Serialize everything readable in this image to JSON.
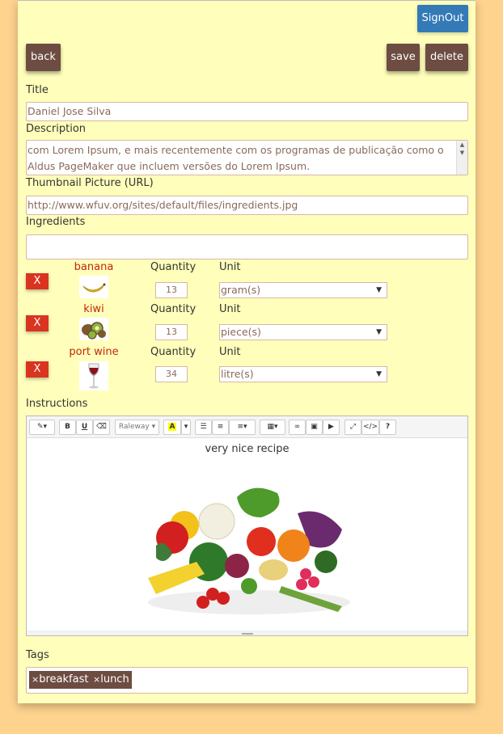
{
  "header": {
    "signout_label": "SignOut"
  },
  "actions": {
    "back_label": "back",
    "save_label": "save",
    "delete_label": "delete"
  },
  "form": {
    "title_label": "Title",
    "title_value": "Daniel Jose Silva",
    "description_label": "Description",
    "description_line1": "com Lorem Ipsum, e mais recentemente com os programas de publicação como o",
    "description_line2": "Aldus PageMaker que incluem versões do Lorem Ipsum.",
    "thumbnail_label": "Thumbnail Picture (URL)",
    "thumbnail_value": "http://www.wfuv.org/sites/default/files/ingredients.jpg",
    "ingredients_label": "Ingredients",
    "ingredients_input": ""
  },
  "ingredients": [
    {
      "remove_label": "X",
      "name": "banana",
      "quantity_label": "Quantity",
      "quantity": "13",
      "unit_label": "Unit",
      "unit": "gram(s)",
      "icon": "banana-icon"
    },
    {
      "remove_label": "X",
      "name": "kiwi",
      "quantity_label": "Quantity",
      "quantity": "13",
      "unit_label": "Unit",
      "unit": "piece(s)",
      "icon": "kiwi-icon"
    },
    {
      "remove_label": "X",
      "name": "port wine",
      "quantity_label": "Quantity",
      "quantity": "34",
      "unit_label": "Unit",
      "unit": "litre(s)",
      "icon": "wine-glass-icon"
    }
  ],
  "instructions": {
    "label": "Instructions",
    "toolbar": {
      "font_label": "Raleway",
      "bold": "B",
      "underline": "U",
      "code": "</>",
      "help": "?"
    },
    "content_text": "very nice recipe",
    "image_icon": "vegetables-image"
  },
  "tags": {
    "label": "Tags",
    "items": [
      {
        "remove": "×",
        "label": "breakfast"
      },
      {
        "remove": "×",
        "label": "lunch"
      }
    ]
  },
  "colors": {
    "background": "#fdd38e",
    "panel": "#ffffbb",
    "primary": "#337ab7",
    "brown": "#6d4c41",
    "danger": "#d9341f",
    "ingredient_name": "#c6240b"
  }
}
